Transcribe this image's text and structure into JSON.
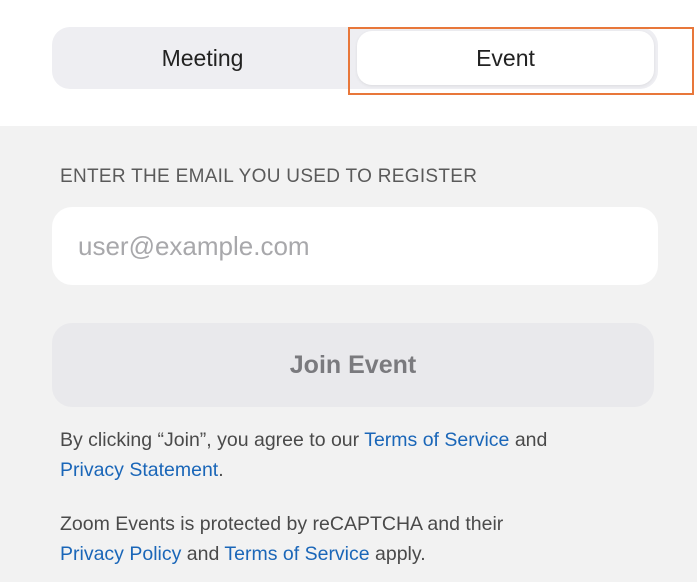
{
  "tabs": {
    "meeting_label": "Meeting",
    "event_label": "Event",
    "selected": "Event"
  },
  "form": {
    "email_label": "ENTER THE EMAIL YOU USED TO REGISTER",
    "email_placeholder": "user@example.com",
    "email_value": "",
    "join_button_label": "Join Event"
  },
  "legal": {
    "consent_prefix": "By clicking “Join”, you agree to our ",
    "consent_terms_link": "Terms of Service",
    "consent_and": " and",
    "consent_privacy_link": "Privacy Statement",
    "consent_suffix": ".",
    "recaptcha_prefix": "Zoom Events is protected by reCAPTCHA and their",
    "recaptcha_privacy_link": "Privacy Policy",
    "recaptcha_and": " and ",
    "recaptcha_terms_link": "Terms of Service",
    "recaptcha_suffix": " apply."
  },
  "colors": {
    "highlight": "#e8773a",
    "link": "#1a66b8",
    "background": "#f2f2f2"
  }
}
